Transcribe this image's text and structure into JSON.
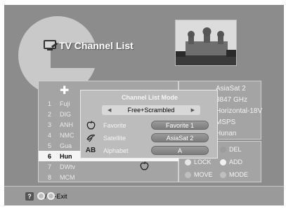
{
  "window": {
    "title": "TV Channel List"
  },
  "channel_list": {
    "channels": [
      {
        "num": "1",
        "name": "Fuji"
      },
      {
        "num": "2",
        "name": "DIG"
      },
      {
        "num": "3",
        "name": "ANH"
      },
      {
        "num": "4",
        "name": "NMC"
      },
      {
        "num": "5",
        "name": "Gua"
      },
      {
        "num": "6",
        "name": "Hun"
      },
      {
        "num": "7",
        "name": "DWtv"
      },
      {
        "num": "8",
        "name": "MCM"
      }
    ],
    "selected_num": "6"
  },
  "info": {
    "satellite": "AsiaSat 2",
    "frequency": "3847 GHz",
    "polarization": "Horizontal-18V",
    "symbol_rate": "MSPS",
    "region": "Hunan"
  },
  "dialog": {
    "title": "Channel List Mode",
    "mode_value": "Free+Scrambled",
    "options": [
      {
        "icon": "apple-icon",
        "label": "Favorite",
        "value": "Favorite 1"
      },
      {
        "icon": "satellite-dish-icon",
        "label": "Satellite",
        "value": "AsiaSat 2"
      },
      {
        "icon": "alphabet-icon",
        "label": "Alphabet",
        "value": "A"
      }
    ]
  },
  "legend": {
    "del": "DEL",
    "lock": "LOCK",
    "add": "ADD",
    "move": "MOVE",
    "mode": "MODE",
    "colors": {
      "red": "#9c9c9c",
      "green": "#e6e6e6",
      "yellow": "#f0f0f0",
      "blue": "#bfbfbf"
    }
  },
  "footer": {
    "help_icon": "?",
    "exit_label": "/",
    "exit_text": "-Exit"
  }
}
